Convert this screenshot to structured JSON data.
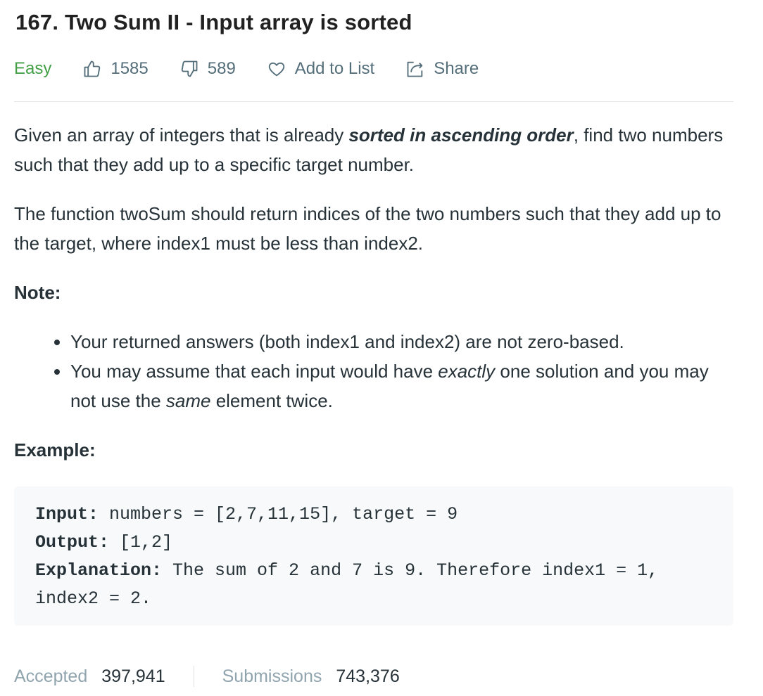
{
  "problem": {
    "title": "167. Two Sum II - Input array is sorted",
    "difficulty": "Easy",
    "likes": "1585",
    "dislikes": "589",
    "add_to_list": "Add to List",
    "share": "Share"
  },
  "description": {
    "p1_a": "Given an array of integers that is already ",
    "p1_bold_italic": "sorted in ascending order",
    "p1_b": ", find two numbers such that they add up to a specific target number.",
    "p2": "The function twoSum should return indices of the two numbers such that they add up to the target, where index1 must be less than index2.",
    "note_heading": "Note:",
    "bullet1": "Your returned answers (both index1 and index2) are not zero-based.",
    "bullet2_a": "You may assume that each input would have ",
    "bullet2_italic1": "exactly",
    "bullet2_b": " one solution and you may not use the ",
    "bullet2_italic2": "same",
    "bullet2_c": " element twice.",
    "example_heading": "Example:"
  },
  "example": {
    "input_label": "Input:",
    "input_value": " numbers = [2,7,11,15], target = 9",
    "output_label": "Output:",
    "output_value": " [1,2]",
    "explanation_label": "Explanation:",
    "explanation_value": " The sum of 2 and 7 is 9. Therefore index1 = 1, index2 = 2."
  },
  "stats": {
    "accepted_label": "Accepted",
    "accepted_value": "397,941",
    "submissions_label": "Submissions",
    "submissions_value": "743,376"
  },
  "colors": {
    "difficulty_easy": "#43a047",
    "muted": "#546e7a",
    "code_bg": "#f7f9fa"
  },
  "icons": [
    "thumbs-up-icon",
    "thumbs-down-icon",
    "heart-icon",
    "share-icon"
  ]
}
